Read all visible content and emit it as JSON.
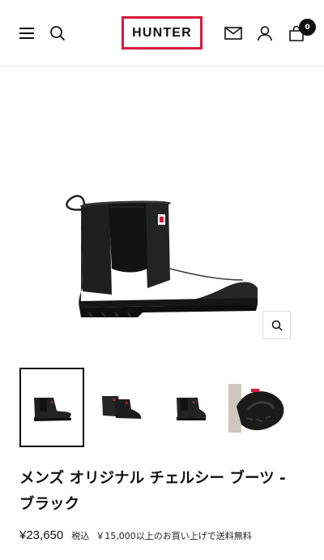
{
  "header": {
    "logo_text": "HUNTER",
    "logo_border_color": "#d41b3c",
    "icons": {
      "menu": "hamburger-menu-icon",
      "search": "search-icon",
      "mail": "mail-icon",
      "account": "user-icon",
      "cart": "shopping-bag-icon"
    },
    "cart_count": "0"
  },
  "product": {
    "main_image": "black-chelsea-rain-boot",
    "zoom_icon": "zoom-magnifier-icon",
    "thumbnails": [
      {
        "label": "single-boot-side-view",
        "selected": true
      },
      {
        "label": "pair-of-boots-front-view",
        "selected": false
      },
      {
        "label": "boot-rear-view",
        "selected": false
      },
      {
        "label": "boot-sole-view",
        "selected": false
      }
    ],
    "title": "メンズ オリジナル チェルシー ブーツ - ブラック",
    "price": "¥23,650",
    "tax_label": "税込",
    "shipping_note": "￥15,000以上のお買い上げで送料無料"
  }
}
